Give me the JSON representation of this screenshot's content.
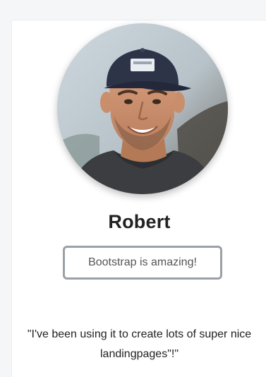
{
  "profile": {
    "name": "Robert",
    "tagline": "Bootstrap is amazing!",
    "quote": "\"I've been using it to create lots of super nice landingpages\"!\""
  },
  "icons": {
    "avatar": "person-photo-icon"
  },
  "colors": {
    "background": "#f5f6f7",
    "card": "#ffffff",
    "badge_border": "#9aa0a6",
    "text": "#222222",
    "muted_text": "#555555"
  }
}
